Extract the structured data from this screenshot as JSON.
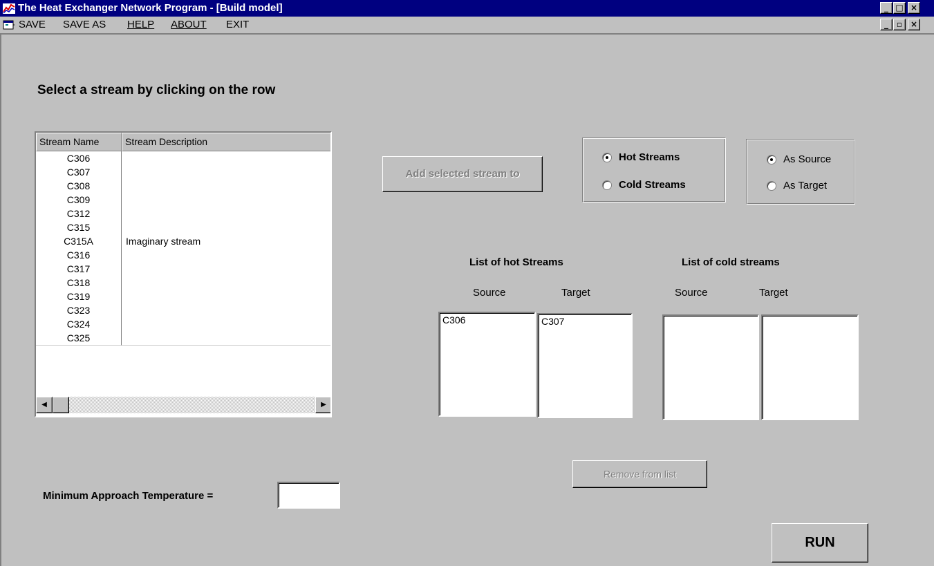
{
  "window": {
    "title": "The Heat Exchanger Network Program - [Build model]",
    "app_icon": "chart-line-icon",
    "controls": [
      "_",
      "□",
      "×"
    ],
    "mdi_controls": [
      "_",
      "🗗",
      "×"
    ]
  },
  "menu": {
    "items": [
      {
        "label": "SAVE"
      },
      {
        "label": "SAVE AS"
      },
      {
        "label": "HELP"
      },
      {
        "label": "ABOUT"
      },
      {
        "label": "EXIT"
      }
    ]
  },
  "instruction": "Select a stream by clicking on the row",
  "grid": {
    "headers": [
      "Stream Name",
      "Stream Description"
    ],
    "rows": [
      {
        "name": "C306",
        "desc": ""
      },
      {
        "name": "C307",
        "desc": ""
      },
      {
        "name": "C308",
        "desc": ""
      },
      {
        "name": "C309",
        "desc": ""
      },
      {
        "name": "C312",
        "desc": ""
      },
      {
        "name": "C315",
        "desc": ""
      },
      {
        "name": "C315A",
        "desc": "Imaginary stream"
      },
      {
        "name": "C316",
        "desc": ""
      },
      {
        "name": "C317",
        "desc": ""
      },
      {
        "name": "C318",
        "desc": ""
      },
      {
        "name": "C319",
        "desc": ""
      },
      {
        "name": "C323",
        "desc": ""
      },
      {
        "name": "C324",
        "desc": ""
      },
      {
        "name": "C325",
        "desc": ""
      }
    ]
  },
  "add_button": "Add selected stream to",
  "stream_type": {
    "options": [
      "Hot Streams",
      "Cold Streams"
    ],
    "selected": "Hot Streams"
  },
  "role": {
    "options": [
      "As Source",
      "As Target"
    ],
    "selected": "As Source"
  },
  "hot_list": {
    "heading": "List of hot Streams",
    "source_label": "Source",
    "target_label": "Target",
    "source_items": [
      "C306"
    ],
    "target_items": [
      "C307"
    ]
  },
  "cold_list": {
    "heading": "List of cold streams",
    "source_label": "Source",
    "target_label": "Target",
    "source_items": [],
    "target_items": []
  },
  "remove_button": "Remove from list",
  "min_temp": {
    "label": "Minimum Approach Temperature =",
    "value": ""
  },
  "run_button": "RUN",
  "colors": {
    "titlebar": "#000080",
    "face": "#c0c0c0",
    "disabled_text": "#808080"
  }
}
